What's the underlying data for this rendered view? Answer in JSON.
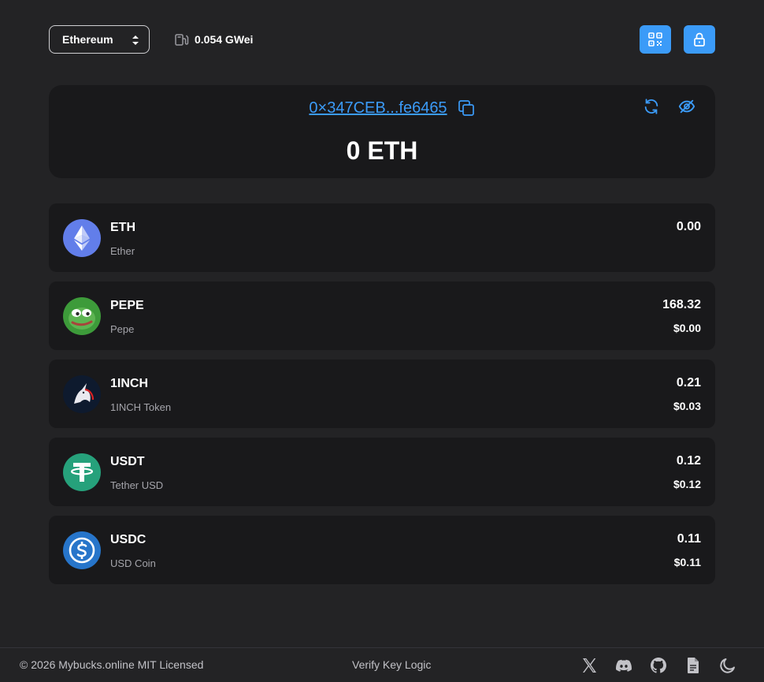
{
  "header": {
    "network": "Ethereum",
    "gas": "0.054 GWei"
  },
  "account": {
    "address": "0×347CEB...fe6465",
    "balance": "0 ETH"
  },
  "tokens": [
    {
      "symbol": "ETH",
      "name": "Ether",
      "amount": "0.00",
      "usd": ""
    },
    {
      "symbol": "PEPE",
      "name": "Pepe",
      "amount": "168.32",
      "usd": "$0.00"
    },
    {
      "symbol": "1INCH",
      "name": "1INCH Token",
      "amount": "0.21",
      "usd": "$0.03"
    },
    {
      "symbol": "USDT",
      "name": "Tether USD",
      "amount": "0.12",
      "usd": "$0.12"
    },
    {
      "symbol": "USDC",
      "name": "USD Coin",
      "amount": "0.11",
      "usd": "$0.11"
    }
  ],
  "footer": {
    "copyright": "© 2026 Mybucks.online MIT Licensed",
    "verify_link": "Verify Key Logic",
    "icons": [
      "x-icon",
      "discord-icon",
      "github-icon",
      "document-icon",
      "moon-icon"
    ]
  },
  "colors": {
    "background": "#232325",
    "card": "#19191b",
    "accent": "#3b9bf8",
    "muted_text": "#a4a4aa"
  }
}
